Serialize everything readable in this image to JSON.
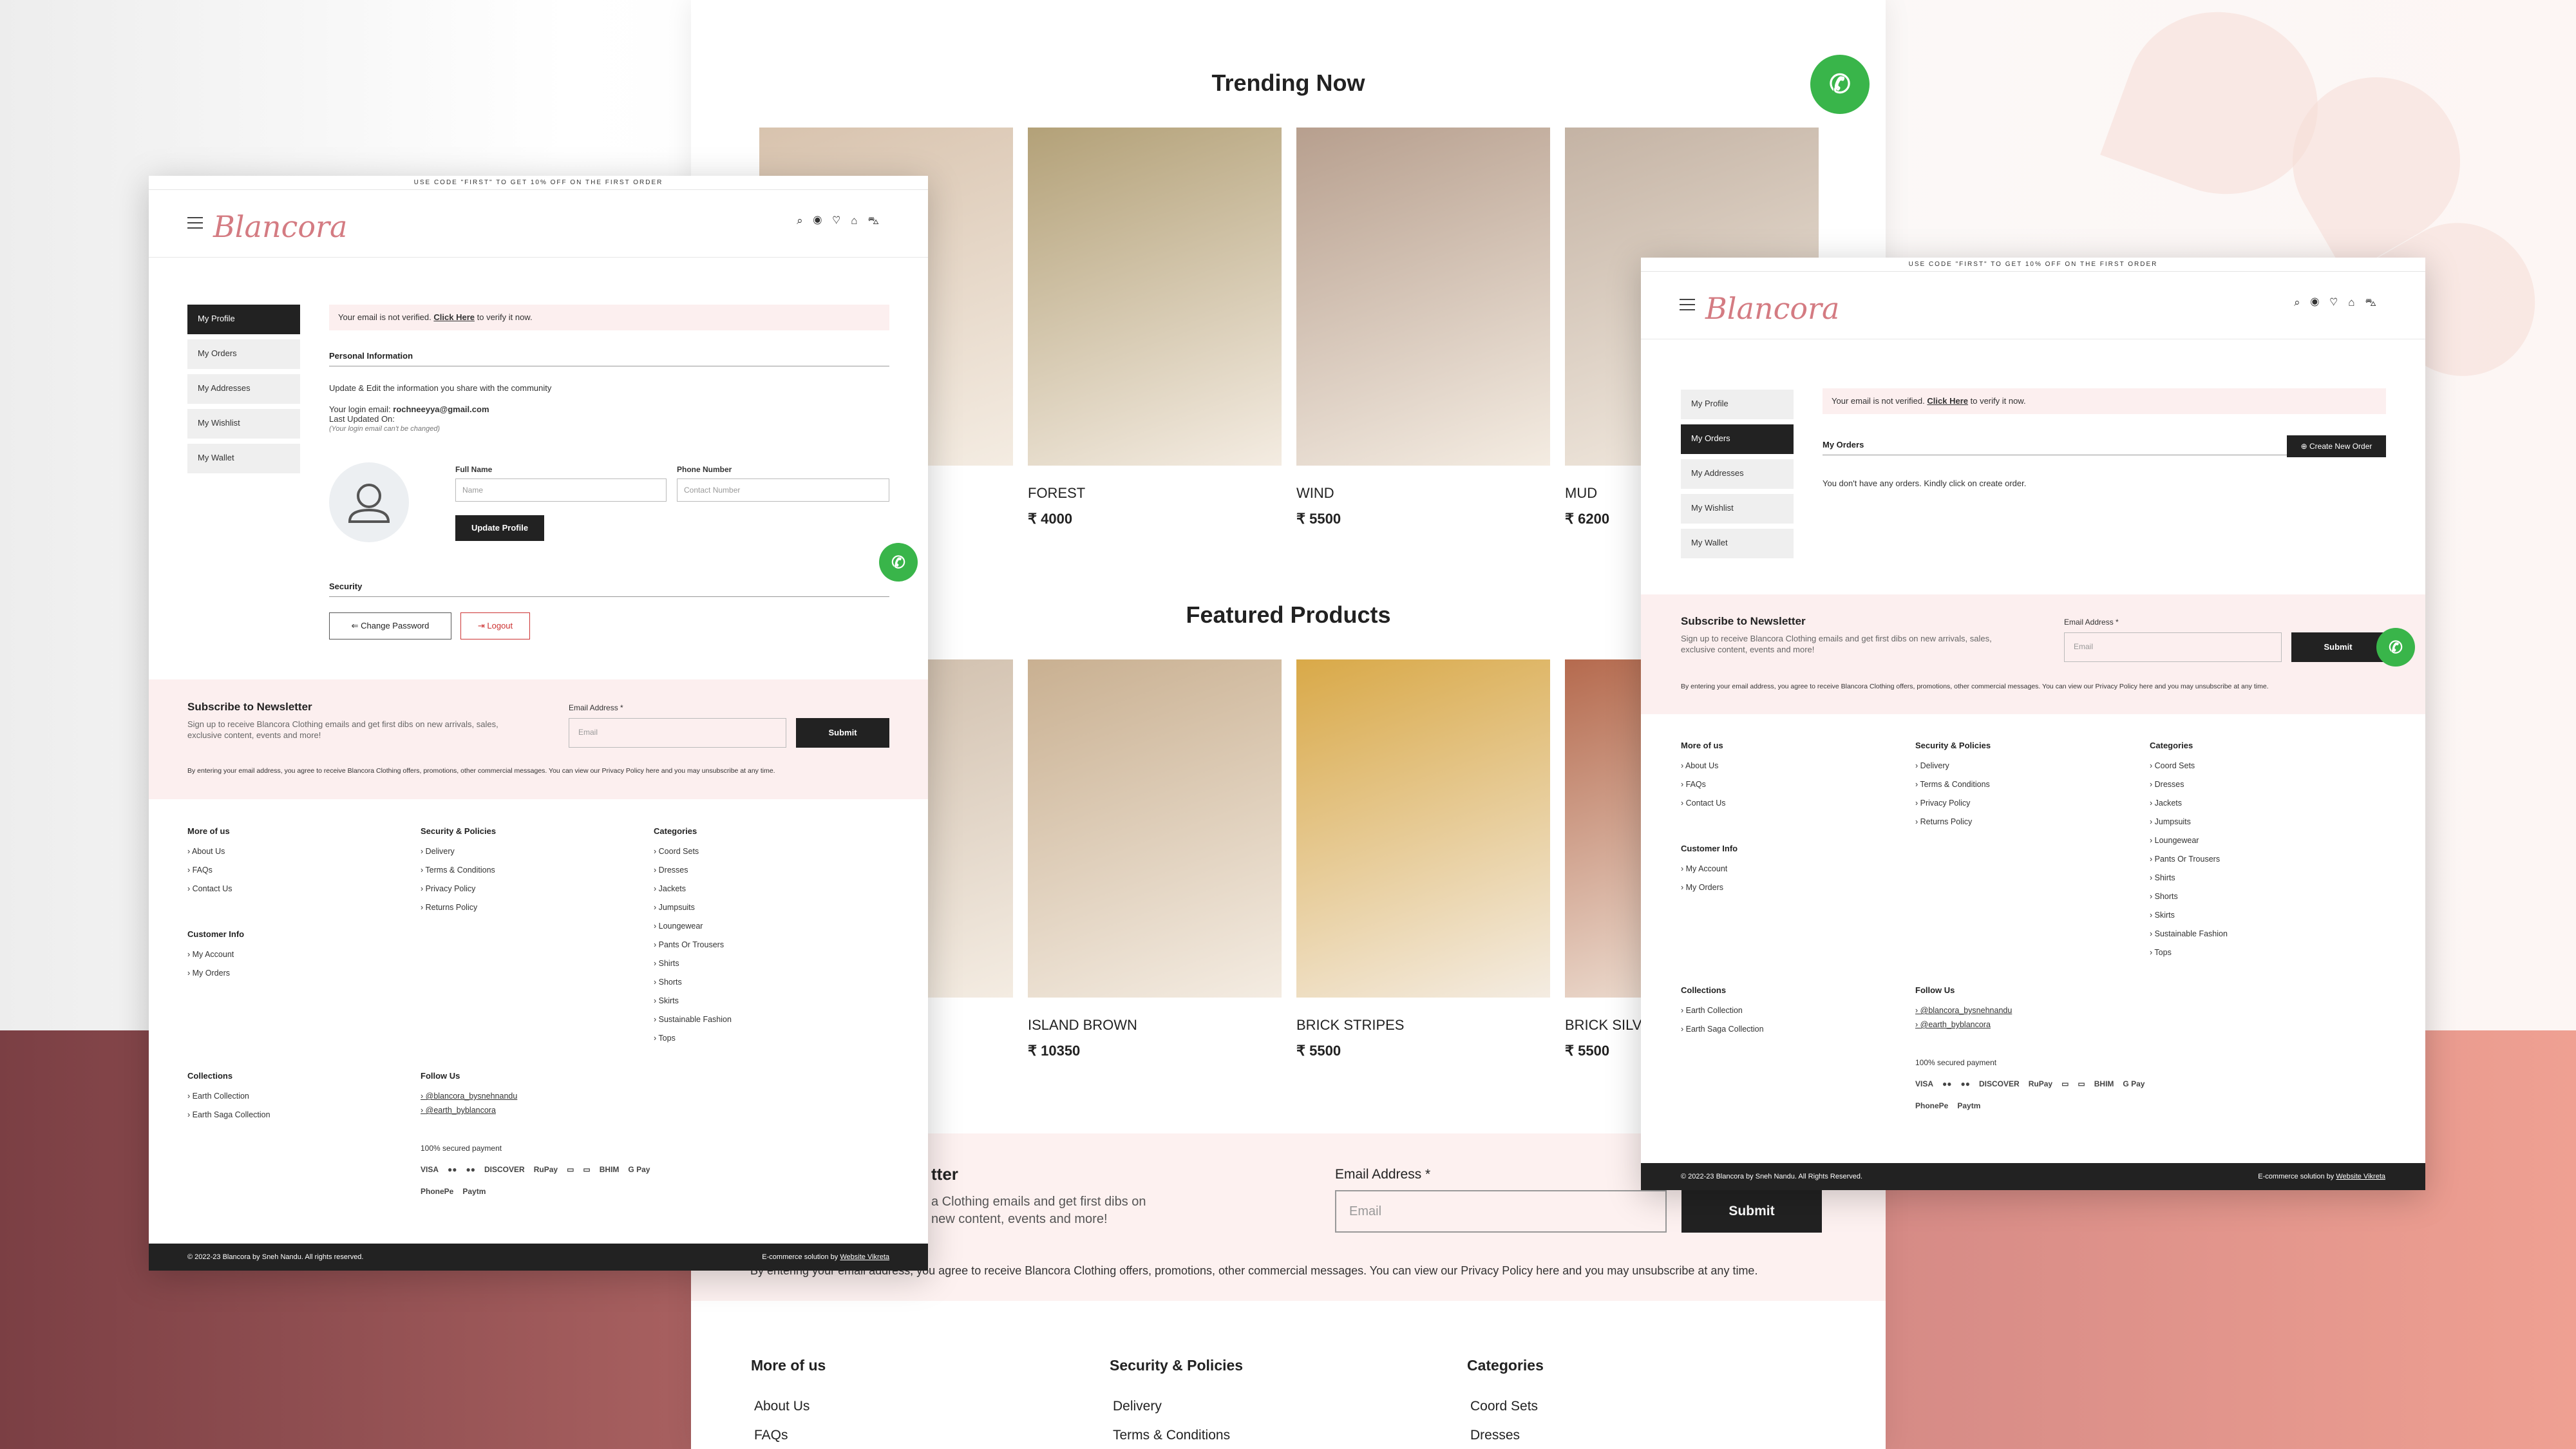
{
  "promo_bar": "USE CODE \"FIRST\" TO GET 10% OFF ON THE FIRST ORDER",
  "brand": "Blancora",
  "header_icons": [
    "search-icon",
    "user-icon",
    "heart-icon",
    "bag-icon",
    "cart-icon"
  ],
  "main_site": {
    "trending_title": "Trending Now",
    "trending": [
      {
        "name": "",
        "price": "",
        "color": "#d8c3ae"
      },
      {
        "name": "FOREST",
        "price": "₹ 4000",
        "color": "#b3a178"
      },
      {
        "name": "WIND",
        "price": "₹ 5500",
        "color": "#b79f8e"
      },
      {
        "name": "MUD",
        "price": "₹ 6200",
        "color": "#c4b3a4"
      }
    ],
    "featured_title": "Featured Products",
    "featured": [
      {
        "name": "",
        "price": "",
        "color": "#cdbba8"
      },
      {
        "name": "ISLAND BROWN",
        "price": "₹ 10350",
        "color": "#c9b091"
      },
      {
        "name": "BRICK STRIPES",
        "price": "₹ 5500",
        "color": "#d9a948"
      },
      {
        "name": "BRICK SILVE",
        "price": "₹ 5500",
        "color": "#b56a4e"
      }
    ],
    "newsletter_partial_title": "tter",
    "newsletter_partial_text": "a Clothing emails and get first dibs on new content, events and more!",
    "email_label": "Email Address *",
    "email_placeholder": "Email",
    "submit": "Submit",
    "disclaimer": "By entering your email address, you agree to receive Blancora Clothing offers, promotions, other commercial messages. You can view our Privacy Policy here and you may unsubscribe at any time.",
    "footer_cols": [
      {
        "title": "More of us",
        "links": [
          "About Us",
          "FAQs"
        ]
      },
      {
        "title": "Security & Policies",
        "links": [
          "Delivery",
          "Terms & Conditions"
        ]
      },
      {
        "title": "Categories",
        "links": [
          "Coord Sets",
          "Dresses"
        ]
      }
    ]
  },
  "account_nav": [
    "My Profile",
    "My Orders",
    "My Addresses",
    "My Wishlist",
    "My Wallet"
  ],
  "alert": {
    "prefix": "Your email is not verified.",
    "link": "Click Here",
    "suffix": "to verify it now."
  },
  "profile": {
    "section_personal": "Personal Information",
    "desc": "Update & Edit the information you share with the community",
    "login_email_label": "Your login email:",
    "login_email": "rochneeyya@gmail.com",
    "last_updated": "Last Updated On:",
    "email_note": "(Your login email can't be changed)",
    "full_name_label": "Full Name",
    "full_name_placeholder": "Name",
    "phone_label": "Phone Number",
    "phone_placeholder": "Contact Number",
    "update_button": "Update Profile",
    "section_security": "Security",
    "change_password": "Change Password",
    "logout": "Logout"
  },
  "orders": {
    "title": "My Orders",
    "create_button": "Create New Order",
    "empty_message": "You don't have any orders. Kindly click on create order."
  },
  "newsletter": {
    "title": "Subscribe to Newsletter",
    "text": "Sign up to receive Blancora Clothing emails and get first dibs on new arrivals, sales, exclusive content, events and more!",
    "email_label": "Email Address *",
    "email_placeholder": "Email",
    "submit": "Submit",
    "disclaimer": "By entering your email address, you agree to receive Blancora Clothing offers, promotions, other commercial messages. You can view our Privacy Policy here and you may unsubscribe at any time."
  },
  "footer": {
    "more_title": "More of us",
    "more_links": [
      "About Us",
      "FAQs",
      "Contact Us"
    ],
    "customer_title": "Customer Info",
    "customer_links": [
      "My Account",
      "My Orders"
    ],
    "policy_title": "Security & Policies",
    "policy_links": [
      "Delivery",
      "Terms & Conditions",
      "Privacy Policy",
      "Returns Policy"
    ],
    "categories_title": "Categories",
    "categories": [
      "Coord Sets",
      "Dresses",
      "Jackets",
      "Jumpsuits",
      "Loungewear",
      "Pants Or Trousers",
      "Shirts",
      "Shorts",
      "Skirts",
      "Sustainable Fashion",
      "Tops"
    ],
    "collections_title": "Collections",
    "collections": [
      "Earth Collection",
      "Earth Saga Collection"
    ],
    "follow_title": "Follow Us",
    "follow": [
      "@blancora_bysnehnandu",
      "@earth_byblancora"
    ],
    "secure": "100% secured payment",
    "payments": [
      "VISA",
      "●●",
      "●●",
      "DISCOVER",
      "RuPay",
      "▭",
      "▭",
      "BHIM",
      "G Pay",
      "PhonePe",
      "Paytm"
    ],
    "copyright": "© 2022-23 Blancora by Sneh Nandu. All Rights Reserved.",
    "copyright_profile": "© 2022-23 Blancora by Sneh Nandu. All rights reserved.",
    "solution_prefix": "E-commerce solution by",
    "solution_link": "Website Vikreta"
  }
}
